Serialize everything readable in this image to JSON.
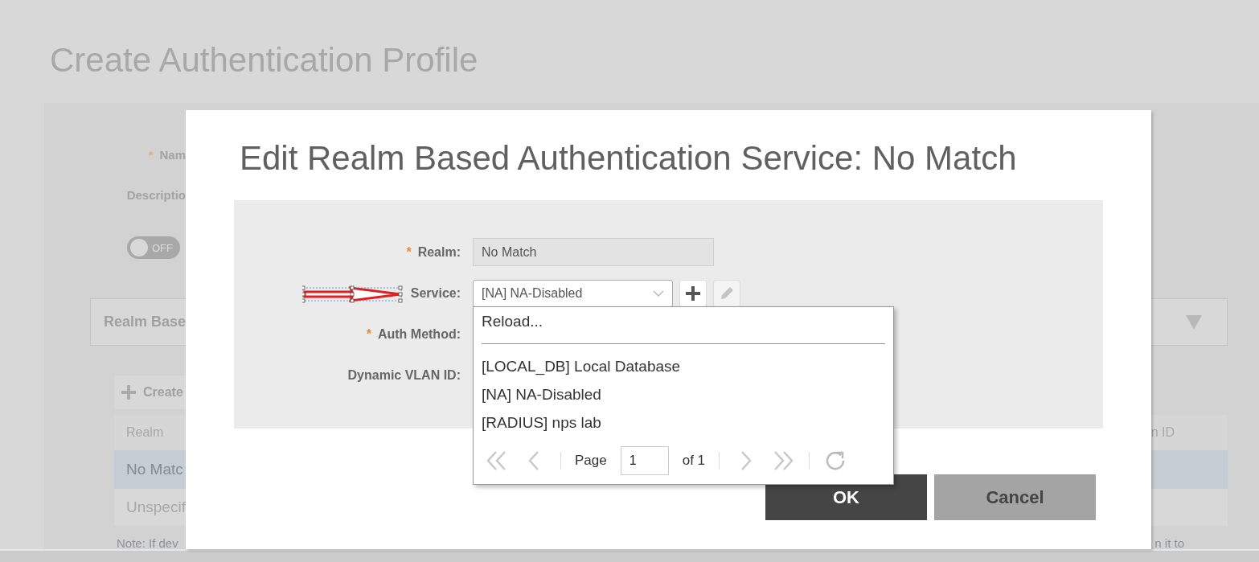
{
  "background_page": {
    "title": "Create Authentication Profile",
    "form_labels": [
      {
        "text": "Nam",
        "required_mark": "*"
      },
      {
        "text": "Descriptio"
      }
    ],
    "toggle": {
      "label": "OFF",
      "on": false
    },
    "accordion": {
      "title": "Realm Base"
    },
    "create_button": "Create",
    "table": {
      "columns": [
        "Realm",
        "n ID"
      ],
      "rows": [
        {
          "cells": [
            "No Matc"
          ],
          "selected": true
        },
        {
          "cells": [
            "Unspecif"
          ],
          "selected": false
        }
      ]
    },
    "note": [
      "Note: If dev",
      "n it to"
    ]
  },
  "dialog": {
    "title": "Edit Realm Based Authentication Service: No Match",
    "fields": [
      {
        "label": "Realm:",
        "required_mark": "*",
        "kind": "text",
        "value": "No Match"
      },
      {
        "label": "Service:",
        "kind": "select",
        "value": "[NA] NA-Disabled"
      },
      {
        "label": "Auth Method:",
        "required_mark": "*",
        "kind": "covered"
      },
      {
        "label": "Dynamic VLAN ID:",
        "kind": "covered"
      }
    ],
    "dropdown": {
      "reload": "Reload...",
      "options": [
        "[LOCAL_DB] Local Database",
        "[NA] NA-Disabled",
        "[RADIUS] nps lab"
      ],
      "pager": {
        "page_label": "Page",
        "page": "1",
        "of": "of 1"
      }
    },
    "buttons": [
      {
        "label": "OK",
        "kind": "primary"
      },
      {
        "label": "Cancel",
        "kind": "secondary"
      }
    ]
  }
}
